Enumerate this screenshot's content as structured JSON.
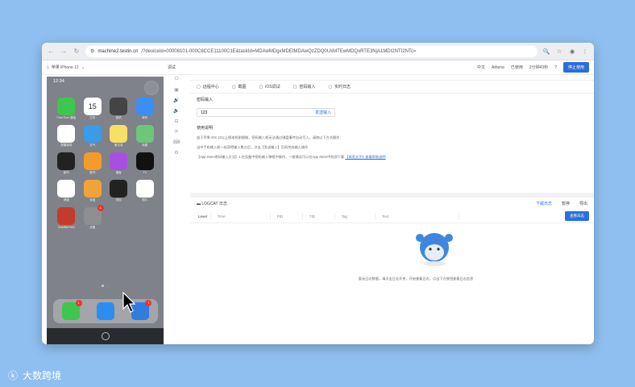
{
  "browser": {
    "url_host": "machine2.testin.cn",
    "url_path": "/?deviceId=00008101-000C6CCE11100C1E&taskId=MDAwMDgxMDEtMDAwQzZDQ0UxMTEwMDQxRTE3NjA1MDI2NTI2NTc="
  },
  "topbar": {
    "device": "苹果 iPhone 12",
    "mode": "调试",
    "lang": "中文",
    "user": "Athena",
    "timer": "已使用",
    "time": "2分钟43秒",
    "end_btn": "停止使用"
  },
  "phone": {
    "time": "12:34",
    "date_num": "15",
    "apps": [
      {
        "label": "FaceTime 通话",
        "color": "#3ec64f"
      },
      {
        "label": "日历",
        "color": "#ffffff"
      },
      {
        "label": "相机",
        "color": "#444"
      },
      {
        "label": "邮件",
        "color": "#3a8ef5"
      },
      {
        "label": "提醒事项",
        "color": "#fff"
      },
      {
        "label": "天气",
        "color": "#3a9be8"
      },
      {
        "label": "备忘录",
        "color": "#f7e066"
      },
      {
        "label": "地图",
        "color": "#6cc779"
      },
      {
        "label": "股市",
        "color": "#222"
      },
      {
        "label": "图书",
        "color": "#f59b2b"
      },
      {
        "label": "播客",
        "color": "#a74fe0"
      },
      {
        "label": "TV",
        "color": "#111"
      },
      {
        "label": "健康",
        "color": "#fff"
      },
      {
        "label": "家庭",
        "color": "#f3a23a"
      },
      {
        "label": "钱包",
        "color": "#222"
      },
      {
        "label": "照片",
        "color": "#fff"
      },
      {
        "label": "GAMBARIAN",
        "color": "#c53b2a"
      },
      {
        "label": "设置",
        "color": "#8e8e93"
      }
    ],
    "settings_badge": "1",
    "dock_badges": [
      "1",
      "1"
    ]
  },
  "tabs": [
    "远程中心",
    "截图",
    "iOS调试",
    "密码输入",
    "实时日志"
  ],
  "password": {
    "title": "密码输入",
    "value": "123",
    "send": "发送输入"
  },
  "help": {
    "title": "使用说明",
    "lines": [
      "由于苹果 iOS 12以上版本机制限制，密码输入框无法通过键盘事件自动写入，请按以下方式操作：",
      "当中手机输入框一处获得输入焦点后，点击【发送输入】后再完成输入操作",
      "【App Store密码输入方法】1.在设备中密码输入弹框中操作，一般情况可以在App Store中检测下载",
      "【高亮文字】查看帮助说明"
    ]
  },
  "logs": {
    "title": "LOGCAT 日志",
    "download": "下载日志",
    "pause": "暂停",
    "export": "导出",
    "filters": [
      "Level",
      "Time",
      "PID",
      "TID",
      "Tag",
      "Text"
    ],
    "find": "查看日志",
    "empty": "暂无日志数据，请点击日志开关，开始查看日志，点击下方按钮查看日志信息"
  },
  "brand": "大数跨境"
}
